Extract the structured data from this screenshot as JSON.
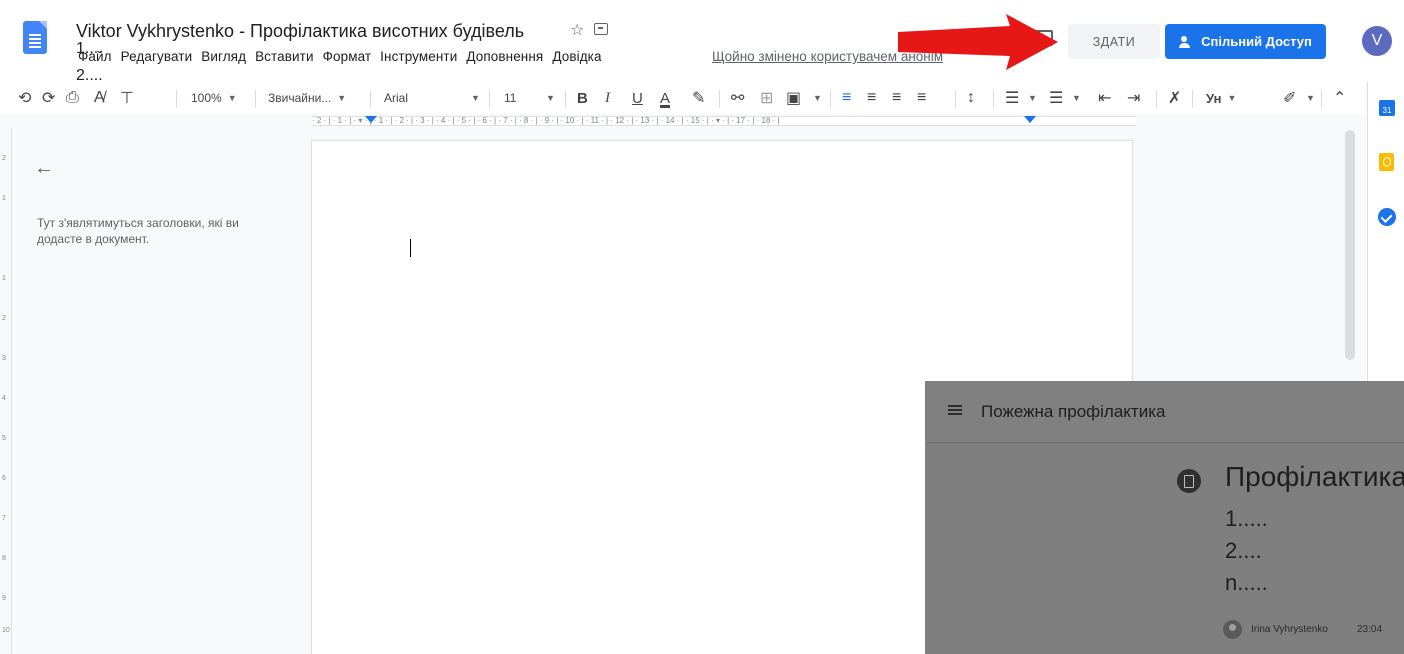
{
  "header": {
    "title": "Viktor Vykhrystenko - Профілактика висотних будівель",
    "star_icon": "☆",
    "overlap_lines": [
      "1....",
      "2...."
    ],
    "menu": [
      "Файл",
      "Редагувати",
      "Вигляд",
      "Вставити",
      "Формат",
      "Інструменти",
      "Доповнення",
      "Довідка"
    ],
    "last_edit": "Щойно змінено користувачем анонім",
    "present_label": "ЗДАТИ",
    "share_label": "Спільний Доступ",
    "avatar_letter": "V"
  },
  "toolbar": {
    "zoom": "100%",
    "style": "Звичайни...",
    "font": "Arial",
    "size": "11",
    "bold": "B",
    "italic": "I",
    "underline": "U",
    "text_color": "A",
    "input_tools": "Ун"
  },
  "ruler": {
    "ticks": "· 2 · | · 1 · | · ▾ · | · 1 · | · 2 · | · 3 · | · 4 · | · 5 · | · 6 · | · 7 · | · 8 · | · 9 · | · 10 · | · 11 · | · 12 · | · 13 · | · 14 · | · 15 · | · ▾ · | · 17 · | · 18 · |"
  },
  "outline": {
    "hint": "Тут з'являтимуться заголовки, які ви додасте в документ."
  },
  "side_panel": {
    "calendar_label": "31"
  },
  "classroom": {
    "topic": "Пожежна профілактика",
    "title": "Профілактика",
    "lines": [
      "1.....",
      "2....",
      "n....."
    ],
    "author": "Irina Vyhrystenko",
    "time": "23:04"
  },
  "colors": {
    "accent": "#1a73e8",
    "arrow": "#e81717",
    "overlay": "#7f7f7f"
  }
}
